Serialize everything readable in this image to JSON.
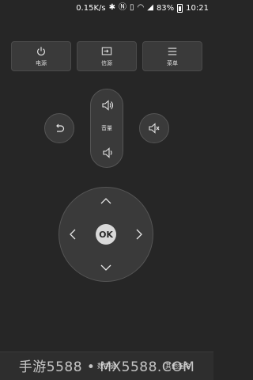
{
  "status_bar": {
    "speed": "0.15K/s",
    "battery_percent": "83%",
    "time": "10:21",
    "icons": [
      "bluetooth-icon",
      "nfc-icon",
      "vibrate-icon",
      "wifi-icon",
      "signal-icon",
      "battery-icon"
    ]
  },
  "top_buttons": {
    "power_label": "电源",
    "source_label": "信源",
    "menu_label": "菜单"
  },
  "volume": {
    "label": "音量"
  },
  "dpad": {
    "ok_label": "OK"
  },
  "bottom_tabs": {
    "numpad_label": "数字键",
    "other_label": "其他指令"
  },
  "watermark": "手游5588 • MX5588.COM",
  "colors": {
    "background": "#262626",
    "button": "#3a3a3a",
    "accent": "#2bb3a3"
  }
}
